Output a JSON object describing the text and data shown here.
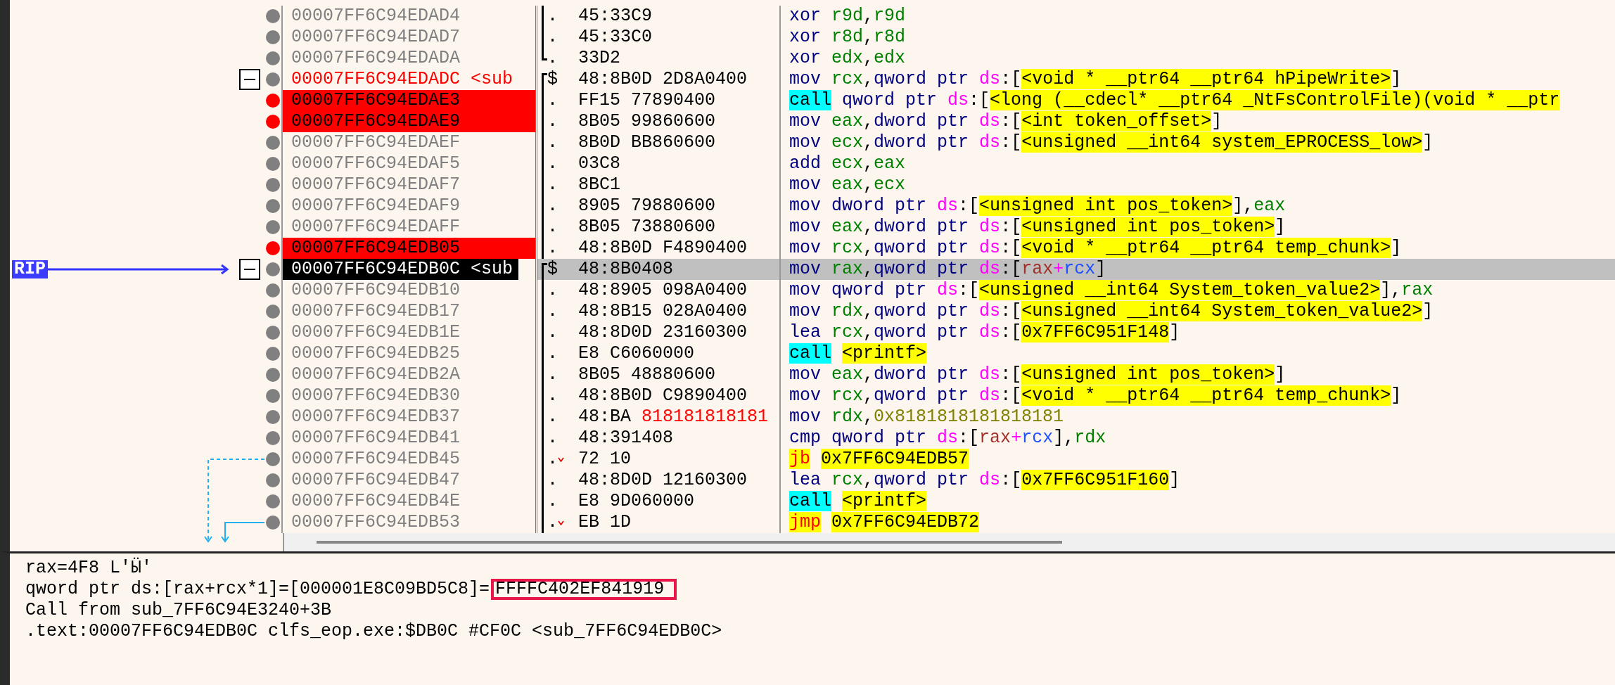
{
  "rows": [
    {
      "address": "00007FF6C94EDAD4",
      "breakpoint": false,
      "selected": false,
      "fold": false,
      "block_start": false,
      "block_end": false,
      "prefix": ".",
      "jump": false,
      "bytes": "45:33C9",
      "instruction": [
        {
          "kind": "mnemonic",
          "text": "xor"
        },
        {
          "kind": "reg",
          "text": "r9d"
        },
        {
          "kind": "plain",
          "text": ","
        },
        {
          "kind": "reg",
          "text": "r9d"
        }
      ]
    },
    {
      "address": "00007FF6C94EDAD7",
      "breakpoint": false,
      "selected": false,
      "fold": false,
      "block_start": false,
      "block_end": false,
      "prefix": ".",
      "jump": false,
      "bytes": "45:33C0",
      "instruction": [
        {
          "kind": "mnemonic",
          "text": "xor"
        },
        {
          "kind": "reg",
          "text": "r8d"
        },
        {
          "kind": "plain",
          "text": ","
        },
        {
          "kind": "reg",
          "text": "r8d"
        }
      ]
    },
    {
      "address": "00007FF6C94EDADA",
      "breakpoint": false,
      "selected": false,
      "fold": false,
      "block_start": false,
      "block_end": true,
      "prefix": ".",
      "jump": false,
      "bytes": "33D2",
      "instruction": [
        {
          "kind": "mnemonic",
          "text": "xor"
        },
        {
          "kind": "reg",
          "text": "edx"
        },
        {
          "kind": "plain",
          "text": ","
        },
        {
          "kind": "reg",
          "text": "edx"
        }
      ]
    },
    {
      "address": "00007FF6C94EDADC",
      "label": "<sub",
      "breakpoint": false,
      "selected": false,
      "fold": true,
      "block_start": true,
      "block_end": false,
      "prefix": "$",
      "jump": false,
      "bytes": "48:8B0D 2D8A0400",
      "instruction": [
        {
          "kind": "mnemonic",
          "text": "mov"
        },
        {
          "kind": "reg",
          "text": "rcx"
        },
        {
          "kind": "plain",
          "text": ","
        },
        {
          "kind": "ptr",
          "text": "qword ptr"
        },
        {
          "kind": "seg",
          "text": "ds"
        },
        {
          "kind": "plain",
          "text": ":["
        },
        {
          "kind": "symbol",
          "text": "<void * __ptr64 __ptr64 hPipeWrite>"
        },
        {
          "kind": "plain",
          "text": "]"
        }
      ]
    },
    {
      "address": "00007FF6C94EDAE3",
      "breakpoint": true,
      "selected": false,
      "fold": false,
      "block_start": false,
      "block_end": false,
      "prefix": ".",
      "jump": false,
      "bytes": "FF15 77890400",
      "instruction": [
        {
          "kind": "call",
          "text": "call"
        },
        {
          "kind": "ptr",
          "text": "qword ptr"
        },
        {
          "kind": "seg",
          "text": "ds"
        },
        {
          "kind": "plain",
          "text": ":["
        },
        {
          "kind": "symbol",
          "text": "<long (__cdecl* __ptr64 _NtFsControlFile)(void * __ptr"
        }
      ]
    },
    {
      "address": "00007FF6C94EDAE9",
      "breakpoint": true,
      "selected": false,
      "fold": false,
      "block_start": false,
      "block_end": false,
      "prefix": ".",
      "jump": false,
      "bytes": "8B05 99860600",
      "instruction": [
        {
          "kind": "mnemonic",
          "text": "mov"
        },
        {
          "kind": "reg",
          "text": "eax"
        },
        {
          "kind": "plain",
          "text": ","
        },
        {
          "kind": "ptr",
          "text": "dword ptr"
        },
        {
          "kind": "seg",
          "text": "ds"
        },
        {
          "kind": "plain",
          "text": ":["
        },
        {
          "kind": "symbol",
          "text": "<int token_offset>"
        },
        {
          "kind": "plain",
          "text": "]"
        }
      ]
    },
    {
      "address": "00007FF6C94EDAEF",
      "breakpoint": false,
      "selected": false,
      "fold": false,
      "block_start": false,
      "block_end": false,
      "prefix": ".",
      "jump": false,
      "bytes": "8B0D BB860600",
      "instruction": [
        {
          "kind": "mnemonic",
          "text": "mov"
        },
        {
          "kind": "reg",
          "text": "ecx"
        },
        {
          "kind": "plain",
          "text": ","
        },
        {
          "kind": "ptr",
          "text": "dword ptr"
        },
        {
          "kind": "seg",
          "text": "ds"
        },
        {
          "kind": "plain",
          "text": ":["
        },
        {
          "kind": "symbol",
          "text": "<unsigned __int64 system_EPROCESS_low>"
        },
        {
          "kind": "plain",
          "text": "]"
        }
      ]
    },
    {
      "address": "00007FF6C94EDAF5",
      "breakpoint": false,
      "selected": false,
      "fold": false,
      "block_start": false,
      "block_end": false,
      "prefix": ".",
      "jump": false,
      "bytes": "03C8",
      "instruction": [
        {
          "kind": "mnemonic",
          "text": "add"
        },
        {
          "kind": "reg",
          "text": "ecx"
        },
        {
          "kind": "plain",
          "text": ","
        },
        {
          "kind": "reg",
          "text": "eax"
        }
      ]
    },
    {
      "address": "00007FF6C94EDAF7",
      "breakpoint": false,
      "selected": false,
      "fold": false,
      "block_start": false,
      "block_end": false,
      "prefix": ".",
      "jump": false,
      "bytes": "8BC1",
      "instruction": [
        {
          "kind": "mnemonic",
          "text": "mov"
        },
        {
          "kind": "reg",
          "text": "eax"
        },
        {
          "kind": "plain",
          "text": ","
        },
        {
          "kind": "reg",
          "text": "ecx"
        }
      ]
    },
    {
      "address": "00007FF6C94EDAF9",
      "breakpoint": false,
      "selected": false,
      "fold": false,
      "block_start": false,
      "block_end": false,
      "prefix": ".",
      "jump": false,
      "bytes": "8905 79880600",
      "instruction": [
        {
          "kind": "mnemonic",
          "text": "mov"
        },
        {
          "kind": "ptr",
          "text": "dword ptr"
        },
        {
          "kind": "seg",
          "text": "ds"
        },
        {
          "kind": "plain",
          "text": ":["
        },
        {
          "kind": "symbol",
          "text": "<unsigned int pos_token>"
        },
        {
          "kind": "plain",
          "text": "],"
        },
        {
          "kind": "reg",
          "text": "eax"
        }
      ]
    },
    {
      "address": "00007FF6C94EDAFF",
      "breakpoint": false,
      "selected": false,
      "fold": false,
      "block_start": false,
      "block_end": false,
      "prefix": ".",
      "jump": false,
      "bytes": "8B05 73880600",
      "instruction": [
        {
          "kind": "mnemonic",
          "text": "mov"
        },
        {
          "kind": "reg",
          "text": "eax"
        },
        {
          "kind": "plain",
          "text": ","
        },
        {
          "kind": "ptr",
          "text": "dword ptr"
        },
        {
          "kind": "seg",
          "text": "ds"
        },
        {
          "kind": "plain",
          "text": ":["
        },
        {
          "kind": "symbol",
          "text": "<unsigned int pos_token>"
        },
        {
          "kind": "plain",
          "text": "]"
        }
      ]
    },
    {
      "address": "00007FF6C94EDB05",
      "breakpoint": true,
      "selected": false,
      "fold": false,
      "block_start": false,
      "block_end": false,
      "prefix": ".",
      "jump": false,
      "bytes": "48:8B0D F4890400",
      "instruction": [
        {
          "kind": "mnemonic",
          "text": "mov"
        },
        {
          "kind": "reg",
          "text": "rcx"
        },
        {
          "kind": "plain",
          "text": ","
        },
        {
          "kind": "ptr",
          "text": "qword ptr"
        },
        {
          "kind": "seg",
          "text": "ds"
        },
        {
          "kind": "plain",
          "text": ":["
        },
        {
          "kind": "symbol",
          "text": "<void * __ptr64 __ptr64 temp_chunk>"
        },
        {
          "kind": "plain",
          "text": "]"
        }
      ]
    },
    {
      "address": "00007FF6C94EDB0C",
      "label": "<sub",
      "rip_label": "RIP",
      "breakpoint": false,
      "selected": true,
      "fold": true,
      "block_start": true,
      "block_end": false,
      "prefix": "$",
      "jump": false,
      "bytes": "48:8B0408",
      "instruction": [
        {
          "kind": "mnemonic",
          "text": "mov"
        },
        {
          "kind": "reg",
          "text": "rax"
        },
        {
          "kind": "plain",
          "text": ","
        },
        {
          "kind": "ptr",
          "text": "qword ptr"
        },
        {
          "kind": "seg",
          "text": "ds"
        },
        {
          "kind": "plain",
          "text": ":["
        },
        {
          "kind": "base",
          "text": "rax"
        },
        {
          "kind": "op",
          "text": "+"
        },
        {
          "kind": "index",
          "text": "rcx"
        },
        {
          "kind": "plain",
          "text": "]"
        }
      ]
    },
    {
      "address": "00007FF6C94EDB10",
      "breakpoint": false,
      "selected": false,
      "fold": false,
      "block_start": false,
      "block_end": false,
      "prefix": ".",
      "jump": false,
      "bytes": "48:8905 098A0400",
      "instruction": [
        {
          "kind": "mnemonic",
          "text": "mov"
        },
        {
          "kind": "ptr",
          "text": "qword ptr"
        },
        {
          "kind": "seg",
          "text": "ds"
        },
        {
          "kind": "plain",
          "text": ":["
        },
        {
          "kind": "symbol",
          "text": "<unsigned __int64 System_token_value2>"
        },
        {
          "kind": "plain",
          "text": "],"
        },
        {
          "kind": "reg",
          "text": "rax"
        }
      ]
    },
    {
      "address": "00007FF6C94EDB17",
      "breakpoint": false,
      "selected": false,
      "fold": false,
      "block_start": false,
      "block_end": false,
      "prefix": ".",
      "jump": false,
      "bytes": "48:8B15 028A0400",
      "instruction": [
        {
          "kind": "mnemonic",
          "text": "mov"
        },
        {
          "kind": "reg",
          "text": "rdx"
        },
        {
          "kind": "plain",
          "text": ","
        },
        {
          "kind": "ptr",
          "text": "qword ptr"
        },
        {
          "kind": "seg",
          "text": "ds"
        },
        {
          "kind": "plain",
          "text": ":["
        },
        {
          "kind": "symbol",
          "text": "<unsigned __int64 System_token_value2>"
        },
        {
          "kind": "plain",
          "text": "]"
        }
      ]
    },
    {
      "address": "00007FF6C94EDB1E",
      "breakpoint": false,
      "selected": false,
      "fold": false,
      "block_start": false,
      "block_end": false,
      "prefix": ".",
      "jump": false,
      "bytes": "48:8D0D 23160300",
      "instruction": [
        {
          "kind": "mnemonic",
          "text": "lea"
        },
        {
          "kind": "reg",
          "text": "rcx"
        },
        {
          "kind": "plain",
          "text": ","
        },
        {
          "kind": "ptr",
          "text": "qword ptr"
        },
        {
          "kind": "seg",
          "text": "ds"
        },
        {
          "kind": "plain",
          "text": ":["
        },
        {
          "kind": "symbol",
          "text": "0x7FF6C951F148"
        },
        {
          "kind": "plain",
          "text": "]"
        }
      ]
    },
    {
      "address": "00007FF6C94EDB25",
      "breakpoint": false,
      "selected": false,
      "fold": false,
      "block_start": false,
      "block_end": false,
      "prefix": ".",
      "jump": false,
      "bytes": "E8 C6060000",
      "instruction": [
        {
          "kind": "call",
          "text": "call"
        },
        {
          "kind": "symbol",
          "text": "<printf>"
        }
      ]
    },
    {
      "address": "00007FF6C94EDB2A",
      "breakpoint": false,
      "selected": false,
      "fold": false,
      "block_start": false,
      "block_end": false,
      "prefix": ".",
      "jump": false,
      "bytes": "8B05 48880600",
      "instruction": [
        {
          "kind": "mnemonic",
          "text": "mov"
        },
        {
          "kind": "reg",
          "text": "eax"
        },
        {
          "kind": "plain",
          "text": ","
        },
        {
          "kind": "ptr",
          "text": "dword ptr"
        },
        {
          "kind": "seg",
          "text": "ds"
        },
        {
          "kind": "plain",
          "text": ":["
        },
        {
          "kind": "symbol",
          "text": "<unsigned int pos_token>"
        },
        {
          "kind": "plain",
          "text": "]"
        }
      ]
    },
    {
      "address": "00007FF6C94EDB30",
      "breakpoint": false,
      "selected": false,
      "fold": false,
      "block_start": false,
      "block_end": false,
      "prefix": ".",
      "jump": false,
      "bytes": "48:8B0D C9890400",
      "instruction": [
        {
          "kind": "mnemonic",
          "text": "mov"
        },
        {
          "kind": "reg",
          "text": "rcx"
        },
        {
          "kind": "plain",
          "text": ","
        },
        {
          "kind": "ptr",
          "text": "qword ptr"
        },
        {
          "kind": "seg",
          "text": "ds"
        },
        {
          "kind": "plain",
          "text": ":["
        },
        {
          "kind": "symbol",
          "text": "<void * __ptr64 __ptr64 temp_chunk>"
        },
        {
          "kind": "plain",
          "text": "]"
        }
      ]
    },
    {
      "address": "00007FF6C94EDB37",
      "breakpoint": false,
      "selected": false,
      "fold": false,
      "block_start": false,
      "block_end": false,
      "prefix": ".",
      "jump": false,
      "bytes": "48:BA",
      "bytes_relocated": "818181818181",
      "instruction": [
        {
          "kind": "mnemonic",
          "text": "mov"
        },
        {
          "kind": "reg",
          "text": "rdx"
        },
        {
          "kind": "plain",
          "text": ","
        },
        {
          "kind": "imm",
          "text": "0x8181818181818181"
        }
      ]
    },
    {
      "address": "00007FF6C94EDB41",
      "breakpoint": false,
      "selected": false,
      "fold": false,
      "block_start": false,
      "block_end": false,
      "prefix": ".",
      "jump": false,
      "bytes": "48:391408",
      "instruction": [
        {
          "kind": "mnemonic",
          "text": "cmp"
        },
        {
          "kind": "ptr",
          "text": "qword ptr"
        },
        {
          "kind": "seg",
          "text": "ds"
        },
        {
          "kind": "plain",
          "text": ":["
        },
        {
          "kind": "base",
          "text": "rax"
        },
        {
          "kind": "op",
          "text": "+"
        },
        {
          "kind": "index",
          "text": "rcx"
        },
        {
          "kind": "plain",
          "text": "],"
        },
        {
          "kind": "reg",
          "text": "rdx"
        }
      ]
    },
    {
      "address": "00007FF6C94EDB45",
      "breakpoint": false,
      "selected": false,
      "fold": false,
      "block_start": false,
      "block_end": false,
      "prefix": ".",
      "jump": true,
      "conditional": true,
      "bytes": "72 10",
      "instruction": [
        {
          "kind": "jump",
          "text": "jb"
        },
        {
          "kind": "symbol",
          "text": "0x7FF6C94EDB57"
        }
      ]
    },
    {
      "address": "00007FF6C94EDB47",
      "breakpoint": false,
      "selected": false,
      "fold": false,
      "block_start": false,
      "block_end": false,
      "prefix": ".",
      "jump": false,
      "bytes": "48:8D0D 12160300",
      "instruction": [
        {
          "kind": "mnemonic",
          "text": "lea"
        },
        {
          "kind": "reg",
          "text": "rcx"
        },
        {
          "kind": "plain",
          "text": ","
        },
        {
          "kind": "ptr",
          "text": "qword ptr"
        },
        {
          "kind": "seg",
          "text": "ds"
        },
        {
          "kind": "plain",
          "text": ":["
        },
        {
          "kind": "symbol",
          "text": "0x7FF6C951F160"
        },
        {
          "kind": "plain",
          "text": "]"
        }
      ]
    },
    {
      "address": "00007FF6C94EDB4E",
      "breakpoint": false,
      "selected": false,
      "fold": false,
      "block_start": false,
      "block_end": false,
      "prefix": ".",
      "jump": false,
      "bytes": "E8 9D060000",
      "instruction": [
        {
          "kind": "call",
          "text": "call"
        },
        {
          "kind": "symbol",
          "text": "<printf>"
        }
      ]
    },
    {
      "address": "00007FF6C94EDB53",
      "breakpoint": false,
      "selected": false,
      "fold": false,
      "block_start": false,
      "block_end": false,
      "prefix": ".",
      "jump": true,
      "conditional": false,
      "bytes": "EB 1D",
      "instruction": [
        {
          "kind": "jump",
          "text": "jmp"
        },
        {
          "kind": "symbol",
          "text": "0x7FF6C94EDB72"
        }
      ]
    }
  ],
  "info_lines": [
    {
      "text": "rax=4F8 L'Ӹ'"
    },
    {
      "text": "qword ptr ds:[rax+rcx*1]=[000001E8C09BD5C8]=",
      "highlighted": "FFFFC402EF841919"
    },
    {
      "text": "Call from sub_7FF6C94E3240+3B"
    },
    {
      "text": ".text:00007FF6C94EDB0C clfs_eop.exe:$DB0C #CF0C <sub_7FF6C94EDB0C>"
    }
  ]
}
